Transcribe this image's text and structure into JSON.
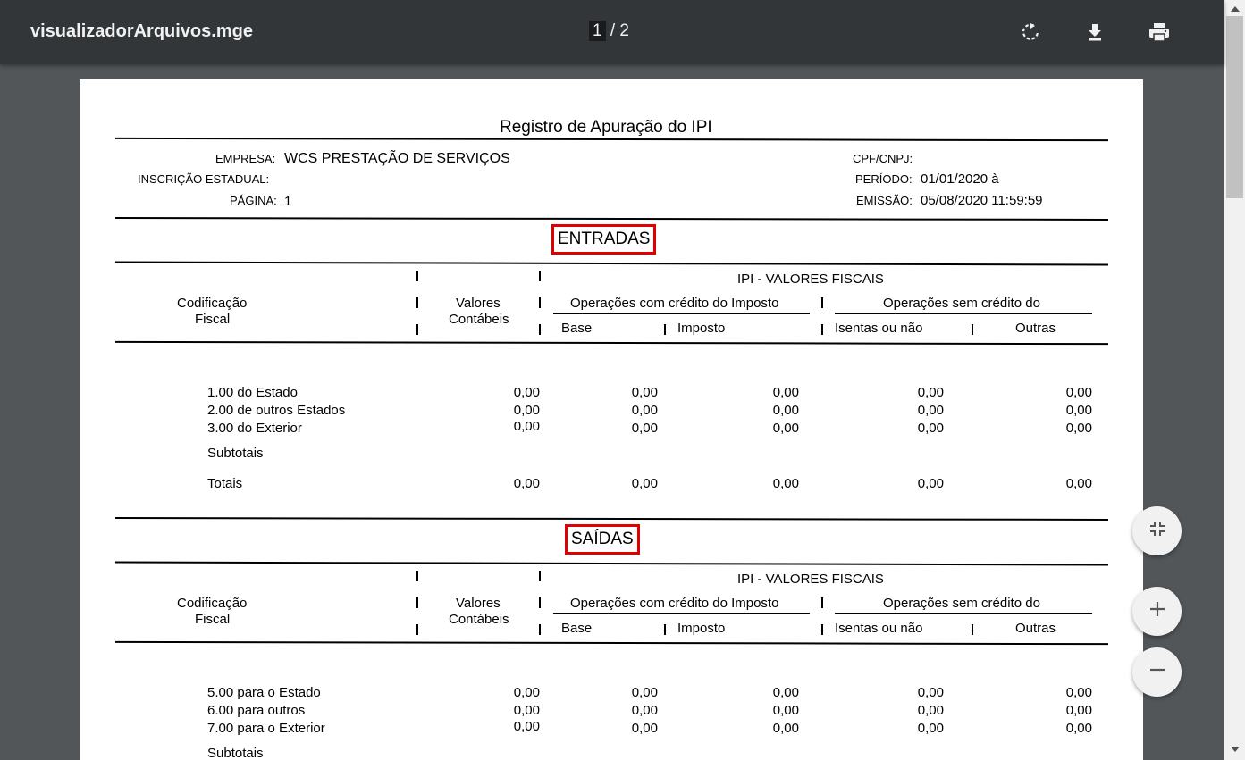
{
  "toolbar": {
    "title": "visualizadorArquivos.mge",
    "page_current": "1",
    "page_sep": " / ",
    "page_total": "2",
    "icons": [
      "rotate-icon",
      "download-icon",
      "print-icon"
    ]
  },
  "report": {
    "title": "Registro de Apuração do IPI",
    "empresa_label": "EMPRESA:",
    "empresa_value": "WCS PRESTAÇÃO DE SERVIÇOS",
    "inscricao_label": "INSCRIÇÃO ESTADUAL:",
    "pagina_label": "PÁGINA:",
    "pagina_value": "1",
    "cnpj_label": "CPF/CNPJ:",
    "periodo_label": "PERÍODO:",
    "periodo_value": "01/01/2020 à",
    "emissao_label": "EMISSÃO:",
    "emissao_value": "05/08/2020 11:59:59",
    "headers": {
      "codificacao": "Codificação",
      "fiscal": "Fiscal",
      "valores": "Valores",
      "contabeis": "Contábeis",
      "ipi": "IPI - VALORES FISCAIS",
      "com_credito": "Operações com crédito do Imposto",
      "sem_credito": "Operações sem crédito do",
      "base": "Base",
      "imposto": "Imposto",
      "isentas": "Isentas ou não",
      "outras": "Outras"
    },
    "entradas": {
      "title": "ENTRADAS",
      "rows": [
        {
          "label": "1.00 do Estado",
          "values": [
            "0,00",
            "0,00",
            "0,00",
            "0,00",
            "0,00"
          ]
        },
        {
          "label": "2.00 de outros Estados",
          "values": [
            "0,00",
            "0,00",
            "0,00",
            "0,00",
            "0,00"
          ]
        },
        {
          "label": "3.00 do Exterior",
          "values": [
            "0,00",
            "0,00",
            "0,00",
            "0,00",
            "0,00"
          ]
        }
      ],
      "subtotais": "Subtotais",
      "totais": "Totais",
      "totais_values": [
        "0,00",
        "0,00",
        "0,00",
        "0,00",
        "0,00"
      ]
    },
    "saidas": {
      "title": "SAÍDAS",
      "rows": [
        {
          "label": "5.00 para o Estado",
          "values": [
            "0,00",
            "0,00",
            "0,00",
            "0,00",
            "0,00"
          ]
        },
        {
          "label": "6.00 para outros",
          "values": [
            "0,00",
            "0,00",
            "0,00",
            "0,00",
            "0,00"
          ]
        },
        {
          "label": "7.00 para o Exterior",
          "values": [
            "0,00",
            "0,00",
            "0,00",
            "0,00",
            "0,00"
          ]
        }
      ],
      "subtotais": "Subtotais"
    }
  },
  "zoom_controls": [
    "fit-page-icon",
    "zoom-in-icon",
    "zoom-out-icon"
  ],
  "colors": {
    "toolbar": "#323639",
    "background": "#525659",
    "highlight": "#e00000"
  }
}
